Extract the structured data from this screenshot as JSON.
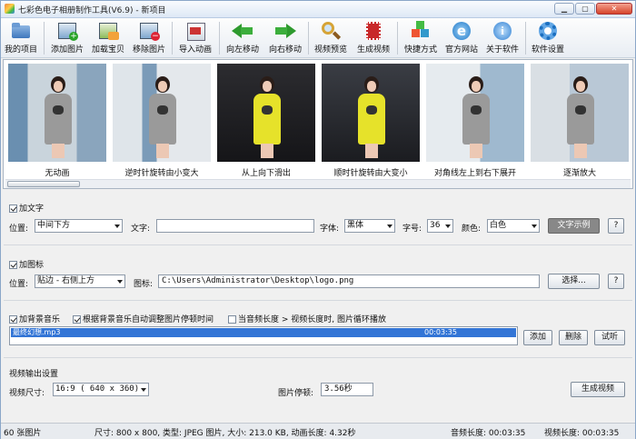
{
  "window": {
    "title": "七彩色电子相册制作工具(V6.9) - 新项目",
    "min": "▁",
    "max": "▢",
    "close": "✕"
  },
  "toolbar": [
    {
      "id": "my-project",
      "label": "我的项目",
      "icon": "folder-icon"
    },
    {
      "id": "add-image",
      "label": "添加图片",
      "icon": "add-image-icon"
    },
    {
      "id": "load-image",
      "label": "加载宝贝",
      "icon": "load-image-icon"
    },
    {
      "id": "remove-image",
      "label": "移除图片",
      "icon": "remove-image-icon"
    },
    {
      "id": "import-animation",
      "label": "导入动画",
      "icon": "import-icon"
    },
    {
      "id": "move-left",
      "label": "向左移动",
      "icon": "arrow-left-icon"
    },
    {
      "id": "move-right",
      "label": "向右移动",
      "icon": "arrow-right-icon"
    },
    {
      "id": "video-preview",
      "label": "视频预览",
      "icon": "magnifier-icon"
    },
    {
      "id": "generate-video",
      "label": "生成视频",
      "icon": "film-icon"
    },
    {
      "id": "shortcut",
      "label": "快捷方式",
      "icon": "cubes-icon"
    },
    {
      "id": "website",
      "label": "官方网站",
      "icon": "ie-icon"
    },
    {
      "id": "about",
      "label": "关于软件",
      "icon": "info-icon"
    },
    {
      "id": "settings",
      "label": "软件设置",
      "icon": "gear-icon"
    }
  ],
  "thumbnails": [
    {
      "caption": "无动画",
      "dress": "#9a9a9a"
    },
    {
      "caption": "逆时针旋转由小变大",
      "dress": "#9a9a9a"
    },
    {
      "caption": "从上向下滑出",
      "dress": "#e6e22a"
    },
    {
      "caption": "顺时针旋转由大变小",
      "dress": "#e6e22a"
    },
    {
      "caption": "对角线左上到右下展开",
      "dress": "#9a9a9a"
    },
    {
      "caption": "逐渐放大",
      "dress": "#9a9a9a"
    }
  ],
  "text_section": {
    "title": "加文字",
    "checked": true,
    "position_label": "位置:",
    "position_value": "中间下方",
    "text_label": "文字:",
    "text_value": "",
    "font_label": "字体:",
    "font_value": "黑体",
    "size_label": "字号:",
    "size_value": "36",
    "color_label": "颜色:",
    "color_value": "白色",
    "example_button": "文字示例",
    "help": "?"
  },
  "icon_section": {
    "title": "加图标",
    "checked": true,
    "position_label": "位置:",
    "position_value": "贴边  - 右侧上方",
    "icon_label": "图标:",
    "icon_path": "C:\\Users\\Administrator\\Desktop\\logo.png",
    "select_button": "选择...",
    "help": "?"
  },
  "music_section": {
    "add_music_label": "加背景音乐",
    "add_music_checked": true,
    "auto_adjust_label": "根据背景音乐自动调整图片停顿时间",
    "auto_adjust_checked": true,
    "loop_label": "当音频长度 > 视频长度时, 图片循环播放",
    "loop_checked": false,
    "tracks": [
      {
        "name": "最终幻想.mp3",
        "duration": "00:03:35"
      }
    ],
    "add_button": "添加",
    "delete_button": "删除",
    "listen_button": "试听"
  },
  "output_section": {
    "title": "视频输出设置",
    "size_label": "视频尺寸:",
    "size_value": "16:9 ( 640 x  360)",
    "pause_label": "图片停顿:",
    "pause_value": "3.56秒",
    "generate_button": "生成视频"
  },
  "status": {
    "count": "60 张图片",
    "info": "尺寸: 800 x 800, 类型: JPEG 图片, 大小: 213.0 KB, 动画长度: 4.32秒",
    "audio_length": "音频长度: 00:03:35",
    "video_length": "视频长度: 00:03:35"
  }
}
